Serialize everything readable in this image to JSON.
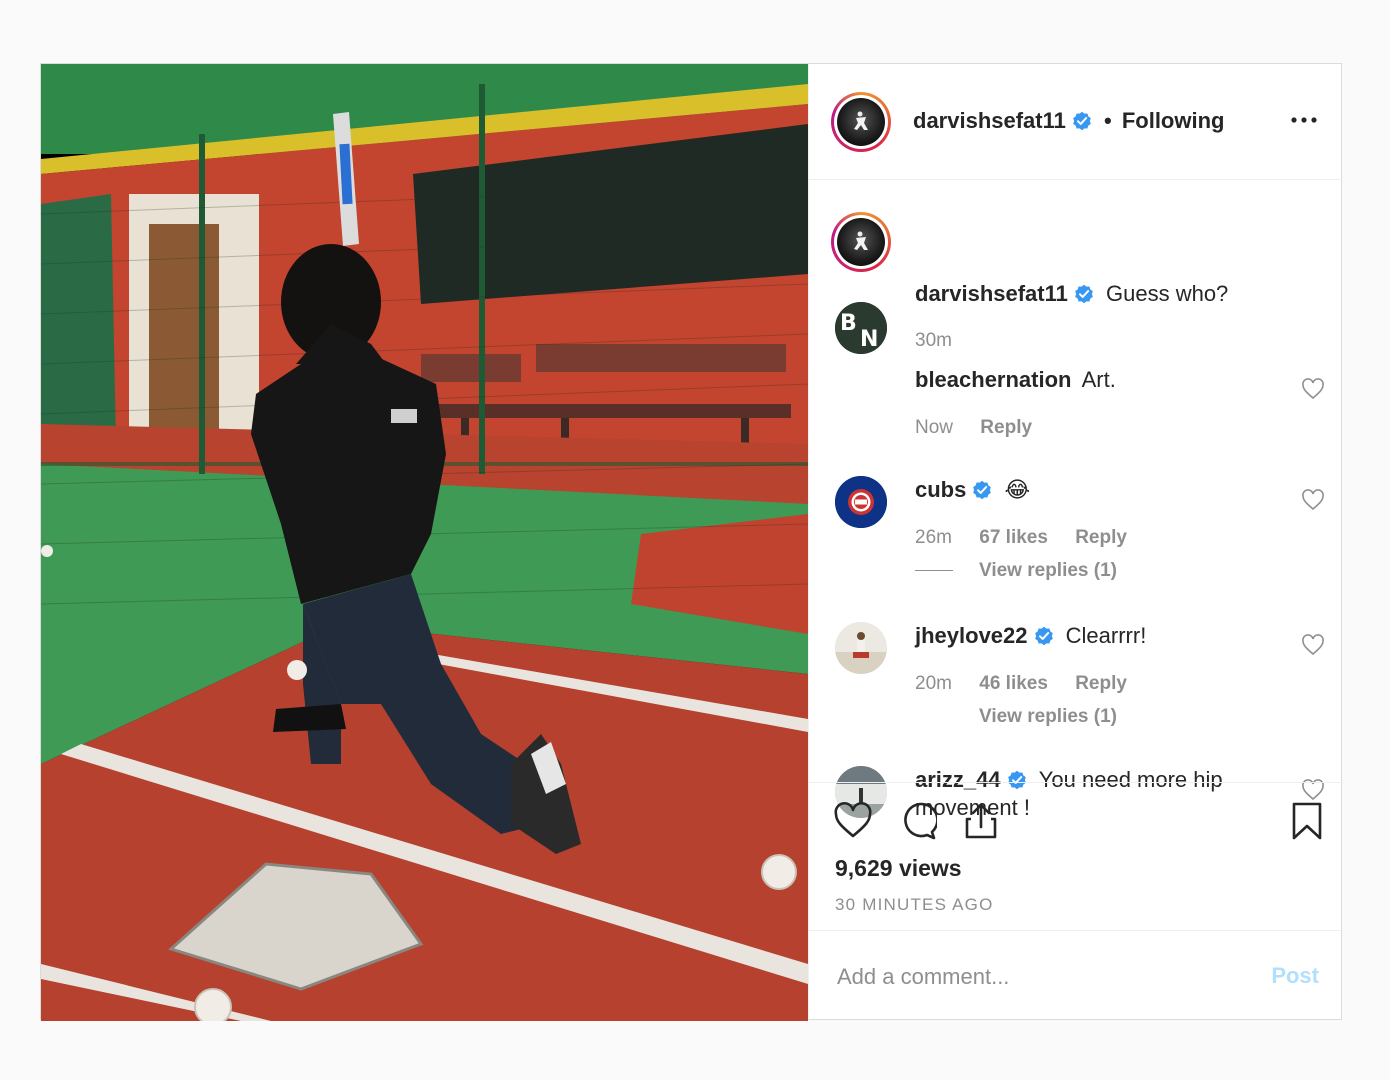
{
  "header": {
    "username": "darvishsefat11",
    "separator": "•",
    "follow_status": "Following"
  },
  "caption": {
    "username": "darvishsefat11",
    "text": "Guess who?",
    "time": "30m"
  },
  "comments": [
    {
      "username": "bleachernation",
      "verified": false,
      "text": "Art.",
      "time": "Now",
      "likes": "",
      "reply": "Reply",
      "avatar_text": "BN"
    },
    {
      "username": "cubs",
      "verified": true,
      "text": "😂",
      "time": "26m",
      "likes": "67 likes",
      "reply": "Reply",
      "view_replies": "View replies (1)"
    },
    {
      "username": "jheylove22",
      "verified": true,
      "text": "Clearrrr!",
      "time": "20m",
      "likes": "46 likes",
      "reply": "Reply",
      "view_replies": "View replies (1)"
    },
    {
      "username": "arizz_44",
      "verified": true,
      "text": "You need more hip movement !"
    }
  ],
  "stats": {
    "views": "9,629 views",
    "posted": "30 MINUTES AGO"
  },
  "add_comment": {
    "placeholder": "Add a comment...",
    "post_label": "Post"
  },
  "colors": {
    "verified_blue": "#3897f0",
    "post_button_disabled": "#b2dffc",
    "muted_text": "#8e8e8e"
  },
  "icons": [
    "more-options-icon",
    "verified-badge-icon",
    "heart-icon",
    "comment-icon",
    "share-icon",
    "bookmark-icon"
  ]
}
